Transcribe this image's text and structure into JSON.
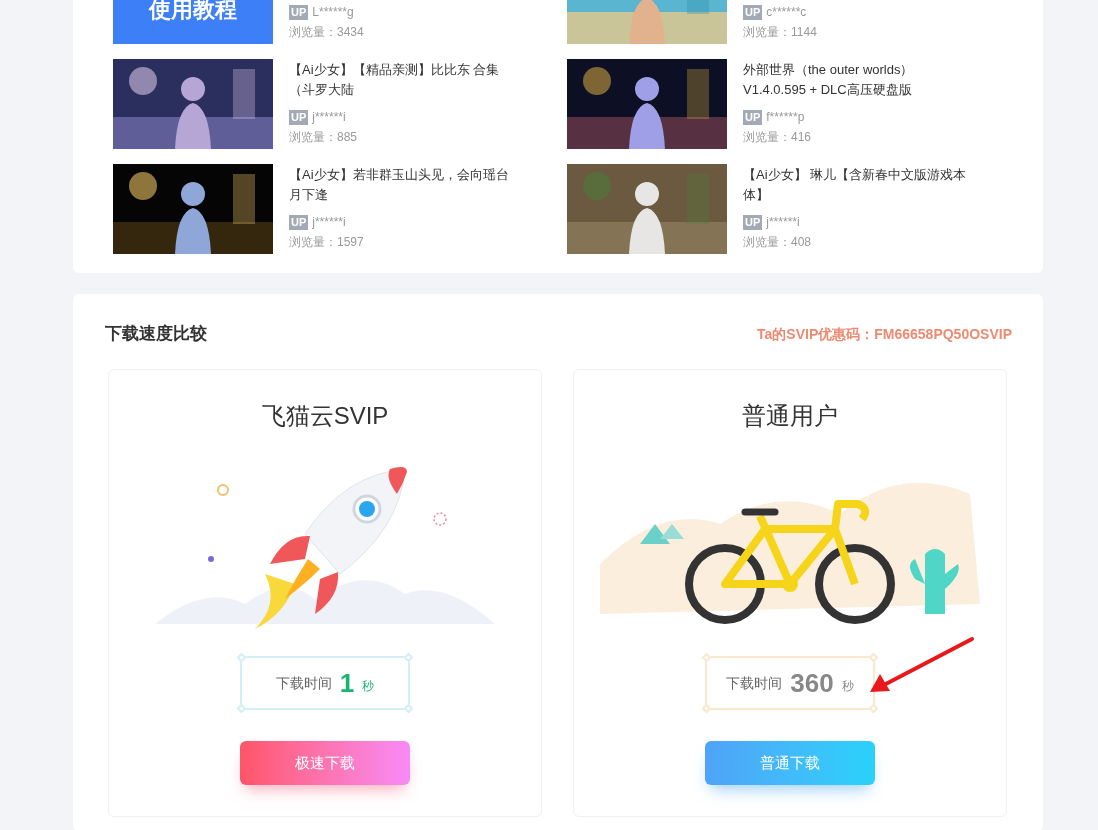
{
  "videos": [
    {
      "kind": "banner",
      "banner_text": "使用教程",
      "uploader_badge": "UP",
      "uploader": "L******g",
      "views": "浏览量：3434"
    },
    {
      "kind": "picture",
      "uploader_badge": "UP",
      "uploader": "c******c",
      "views": "浏览量：1144"
    },
    {
      "kind": "picture",
      "title": "【Ai少女】【精品亲测】比比东 合集（斗罗大陆",
      "uploader_badge": "UP",
      "uploader": "j******i",
      "views": "浏览量：885"
    },
    {
      "kind": "picture",
      "title": "外部世界（the outer worlds）V1.4.0.595 + DLC高压硬盘版",
      "uploader_badge": "UP",
      "uploader": "f******p",
      "views": "浏览量：416"
    },
    {
      "kind": "picture",
      "title": "【Ai少女】若非群玉山头见，会向瑶台月下逢",
      "uploader_badge": "UP",
      "uploader": "j******i",
      "views": "浏览量：1597"
    },
    {
      "kind": "picture",
      "title": "【Ai少女】 琳儿【含新春中文版游戏本体】",
      "uploader_badge": "UP",
      "uploader": "j******i",
      "views": "浏览量：408"
    }
  ],
  "speed_comparison": {
    "title": "下载速度比较",
    "coupon": "Ta的SVIP优惠码：FM66658PQ50OSVIP",
    "plans": [
      {
        "kind": "svip",
        "name": "飞猫云SVIP",
        "time_label": "下载时间",
        "time_value": "1",
        "time_unit": "秒",
        "button": "极速下载"
      },
      {
        "kind": "normal",
        "name": "普通用户",
        "time_label": "下载时间",
        "time_value": "360",
        "time_unit": "秒",
        "button": "普通下载"
      }
    ]
  }
}
